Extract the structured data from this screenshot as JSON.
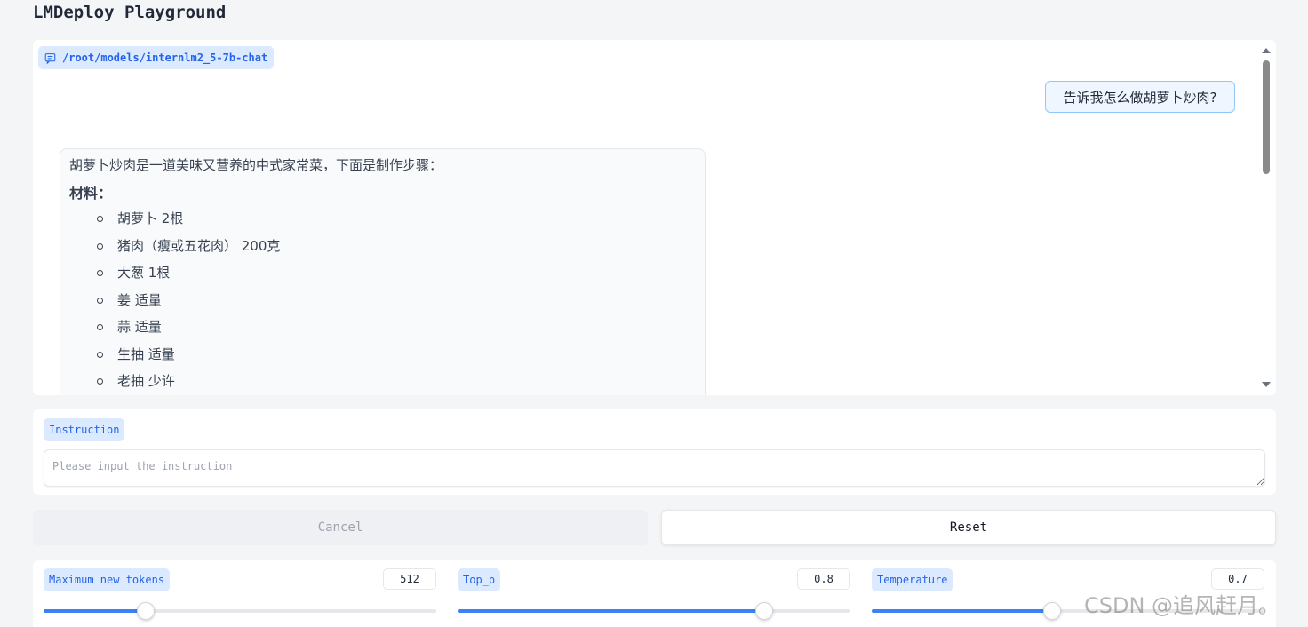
{
  "app": {
    "title": "LMDeploy Playground"
  },
  "chatbot": {
    "model_label": "/root/models/internlm2_5-7b-chat",
    "user_message": "告诉我怎么做胡萝卜炒肉?",
    "bot_message": {
      "intro": "胡萝卜炒肉是一道美味又营养的中式家常菜，下面是制作步骤：",
      "heading": "材料：",
      "items": [
        "胡萝卜 2根",
        "猪肉（瘦或五花肉） 200克",
        "大葱 1根",
        "姜 适量",
        "蒜 适量",
        "生抽 适量",
        "老抽 少许"
      ]
    }
  },
  "instruction": {
    "label": "Instruction",
    "placeholder": "Please input the instruction"
  },
  "buttons": {
    "cancel": "Cancel",
    "reset": "Reset"
  },
  "params": [
    {
      "label": "Maximum new tokens",
      "value": "512",
      "fraction": 0.26
    },
    {
      "label": "Top_p",
      "value": "0.8",
      "fraction": 0.78
    },
    {
      "label": "Temperature",
      "value": "0.7",
      "fraction": 0.46
    }
  ],
  "watermark": "CSDN @追风赶月。",
  "colors": {
    "accent": "#3b82f6",
    "tag_bg": "#dbeafe",
    "tag_text": "#2563eb"
  }
}
